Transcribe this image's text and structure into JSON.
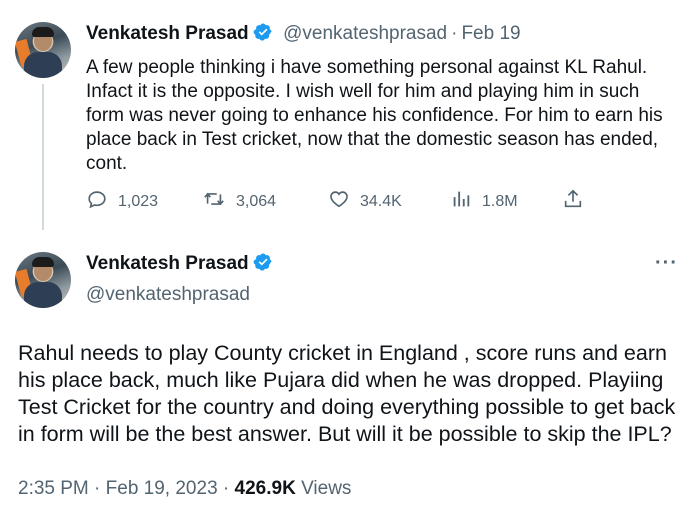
{
  "colors": {
    "text": "#0f1419",
    "muted": "#536471",
    "verified": "#1d9bf0",
    "line": "#cfd9de"
  },
  "tweet1": {
    "name": "Venkatesh Prasad",
    "handle": "@venkateshprasad",
    "date": "Feb 19",
    "text": "A few people thinking i have something personal against KL Rahul. Infact it is the opposite. I wish well for him and playing him in such form was never going to enhance his confidence. For him to earn his place back in Test cricket, now that the domestic season has ended, cont.",
    "actions": {
      "replies": "1,023",
      "retweets": "3,064",
      "likes": "34.4K",
      "views": "1.8M"
    },
    "icons": [
      "reply-icon",
      "retweet-icon",
      "like-icon",
      "views-icon",
      "share-icon"
    ]
  },
  "tweet2": {
    "name": "Venkatesh Prasad",
    "handle": "@venkateshprasad",
    "more": "···",
    "text": "Rahul needs to play County cricket in England , score runs and earn his place back, much like Pujara did when he was dropped.  Playiing Test Cricket for the country and doing everything possible to get back in form will be the best answer. But will it be possible to skip the IPL?",
    "time": "2:35 PM",
    "date": "Feb 19, 2023",
    "views_count": "426.9K",
    "views_label": "Views"
  }
}
